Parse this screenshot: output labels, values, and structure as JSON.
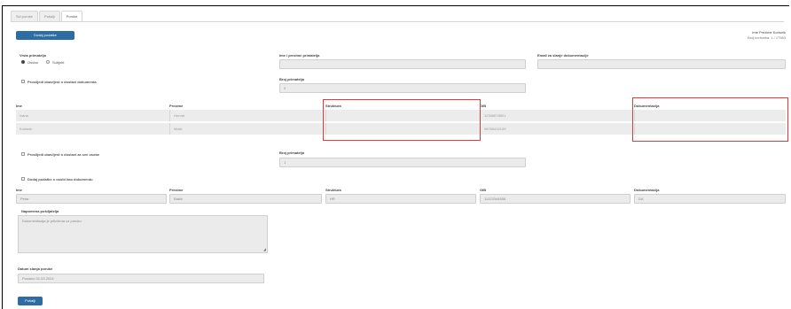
{
  "tabs": [
    "Svi poruke",
    "Pošalji",
    "Poruke"
  ],
  "active_tab": 2,
  "top_button": "Dodaj podatke",
  "user": {
    "name": "Ime Prezime Korisnik",
    "sub": "Broj korisnika: 1 / 17583"
  },
  "sections": {
    "recipient_type_label": "Vrsta primatelja",
    "radio_person": "Osoba",
    "radio_company": "Subjekt",
    "subject_label": "Ime i prezime primatelja",
    "email_label": "Email za slanje dokumentacije",
    "check1": "Proslijedi obavijest o dostavi dokumenta",
    "count_label_1": "Broj primatelja",
    "count_value_1": "2",
    "check2": "Proslijedi obavijest o dostavi za sve osobe",
    "count_label_2": "Broj primatelja",
    "count_value_2": "1",
    "check3": "Dodaj podatke o osobi kao dokumentu"
  },
  "table1": {
    "headers": [
      "Ime",
      "Prezime",
      "Struktura",
      "OIB",
      "Dokumentacija"
    ],
    "rows": [
      [
        "Ivana",
        "Horvat",
        "",
        "12345678901",
        ""
      ],
      [
        "Korisnik",
        "Matić",
        "",
        "98765432100",
        ""
      ]
    ]
  },
  "table2": {
    "headers": [
      "Ime",
      "Prezime",
      "Struktura",
      "OIB",
      "Dokumentacija"
    ],
    "rows": [
      [
        "Petar",
        "Babić",
        "HR",
        "11223344556",
        "DA"
      ]
    ]
  },
  "note_label": "Napomena pošiljatelja",
  "note_value": "Dokumentacija je priložena uz poruku",
  "date_label": "Datum slanja poruke",
  "date_value": "Poslano 01.03.2024",
  "submit_button": "Pošalji"
}
